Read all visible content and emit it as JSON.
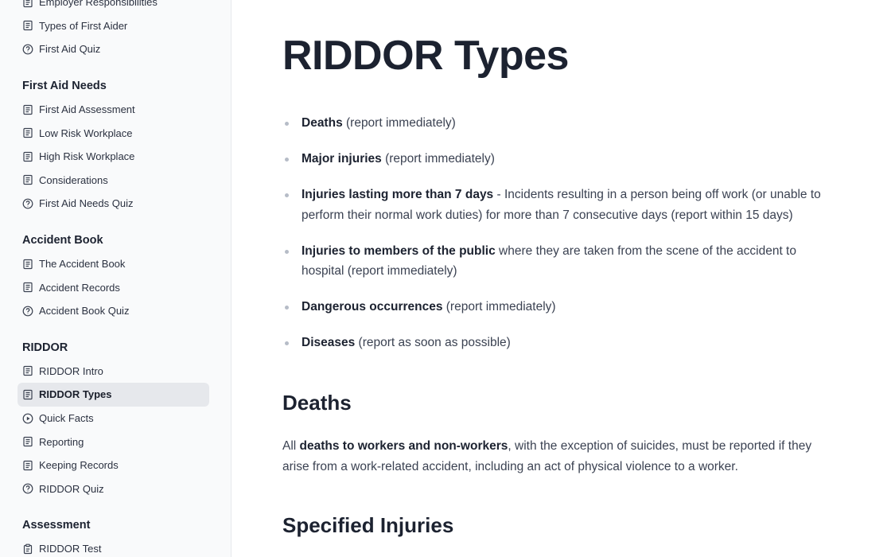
{
  "sidebar": {
    "top_items": [
      {
        "label": "Employer Responsibilities",
        "icon": "document-icon"
      },
      {
        "label": "Types of First Aider",
        "icon": "document-icon"
      },
      {
        "label": "First Aid Quiz",
        "icon": "quiz-icon"
      }
    ],
    "sections": [
      {
        "heading": "First Aid Needs",
        "items": [
          {
            "label": "First Aid Assessment",
            "icon": "document-icon"
          },
          {
            "label": "Low Risk Workplace",
            "icon": "document-icon"
          },
          {
            "label": "High Risk Workplace",
            "icon": "document-icon"
          },
          {
            "label": "Considerations",
            "icon": "document-icon"
          },
          {
            "label": "First Aid Needs Quiz",
            "icon": "quiz-icon"
          }
        ]
      },
      {
        "heading": "Accident Book",
        "items": [
          {
            "label": "The Accident Book",
            "icon": "document-icon"
          },
          {
            "label": "Accident Records",
            "icon": "document-icon"
          },
          {
            "label": "Accident Book Quiz",
            "icon": "quiz-icon"
          }
        ]
      },
      {
        "heading": "RIDDOR",
        "items": [
          {
            "label": "RIDDOR Intro",
            "icon": "document-icon"
          },
          {
            "label": "RIDDOR Types",
            "icon": "document-icon",
            "active": true
          },
          {
            "label": "Quick Facts",
            "icon": "play-icon"
          },
          {
            "label": "Reporting",
            "icon": "document-icon"
          },
          {
            "label": "Keeping Records",
            "icon": "document-icon"
          },
          {
            "label": "RIDDOR Quiz",
            "icon": "quiz-icon"
          }
        ]
      },
      {
        "heading": "Assessment",
        "items": [
          {
            "label": "RIDDOR Test",
            "icon": "clipboard-icon"
          }
        ]
      }
    ]
  },
  "main": {
    "title": "RIDDOR Types",
    "bullets": [
      {
        "bold": "Deaths",
        "text": " (report immediately)"
      },
      {
        "bold": "Major injuries",
        "text": " (report immediately)"
      },
      {
        "bold": "Injuries lasting more than 7 days",
        "text": " - Incidents resulting in a person being off work (or unable to perform their normal work duties) for more than 7 consecutive days (report within 15 days)"
      },
      {
        "bold": "Injuries to members of the public",
        "text": " where they are taken from the scene of the accident to hospital (report immediately)"
      },
      {
        "bold": "Dangerous occurrences",
        "text": " (report immediately)"
      },
      {
        "bold": "Diseases",
        "text": " (report as soon as possible)"
      }
    ],
    "deaths_heading": "Deaths",
    "deaths_para": {
      "prefix": "All ",
      "bold": "deaths to workers and non-workers",
      "suffix": ", with the exception of suicides, must be reported if they arise from a work-related accident, including an act of physical violence to a worker."
    },
    "specified_heading": "Specified Injuries"
  },
  "colors": {
    "sidebar_bg": "#f9fafb",
    "active_item_bg": "#e6e8ec",
    "heading_text": "#1c2230",
    "body_text": "#3b4252",
    "bullet_dot": "#b6bcc7"
  }
}
